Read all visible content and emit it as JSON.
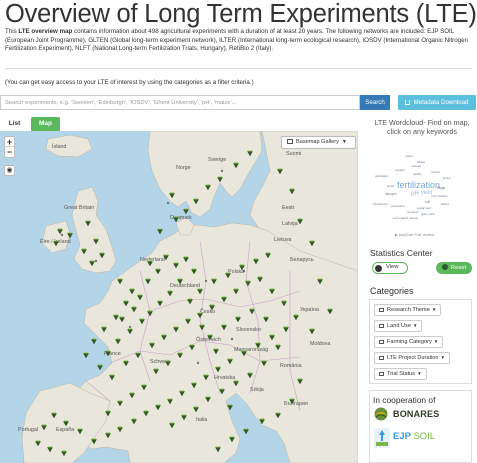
{
  "header": {
    "title": "Overview of Long Term Experiments (LTE)",
    "intro_part1": "This ",
    "intro_bold": "LTE overview map",
    "intro_part2": " contains information about 498 agricultural experiments with a duration of at least 20 years. The following networks are included: EJP SOIL (European Joint Programme), GLTEN (Global long-term experiment network), ILTER (International long-term ecological research), IOSDV (International Organic Nitrogen Fertilization Experiment), NLFT (National Long-term Fertilization Trials, Hungary), RetiBio 2 (Italy).",
    "hint": "(You can get easy access to your LTE of interest by using the categories as a filter criteria.)"
  },
  "search": {
    "placeholder": "Search experiments, e.g. 'Sweden', 'Edinburgh', 'IOSDV', 'Ghent University', 'pH', 'maize'...",
    "button_label": "Search"
  },
  "metadata_button": {
    "label": "Metadata Download",
    "icon": "download-icon"
  },
  "tabs": [
    {
      "label": "List",
      "active": false
    },
    {
      "label": "Map",
      "active": true
    }
  ],
  "map": {
    "zoom_in": "+",
    "zoom_out": "−",
    "basemap_label": "Basemap Gallery",
    "labels": [
      {
        "text": "Ísland"
      },
      {
        "text": "Norge"
      },
      {
        "text": "Sverige"
      },
      {
        "text": "Suomi"
      },
      {
        "text": "Eesti"
      },
      {
        "text": "Latvija"
      },
      {
        "text": "Lietuva"
      },
      {
        "text": "Danmark"
      },
      {
        "text": "Great Britain"
      },
      {
        "text": "Éire / Ireland"
      },
      {
        "text": "Nederland"
      },
      {
        "text": "Deutschland"
      },
      {
        "text": "Polska"
      },
      {
        "text": "Беларусь"
      },
      {
        "text": "Україна"
      },
      {
        "text": "France"
      },
      {
        "text": "Česko"
      },
      {
        "text": "Slovensko"
      },
      {
        "text": "Österreich"
      },
      {
        "text": "Magyarország"
      },
      {
        "text": "România"
      },
      {
        "text": "Italia"
      },
      {
        "text": "España"
      },
      {
        "text": "Portugal"
      },
      {
        "text": "Schweiz"
      },
      {
        "text": "Moldova"
      },
      {
        "text": "Hrvatska"
      },
      {
        "text": "Srbija"
      },
      {
        "text": "България"
      }
    ]
  },
  "wordcloud": {
    "title": "LTE Wordcloud- Find on map, click on any keywords",
    "words": [
      {
        "text": "fertilization"
      },
      {
        "text": "pH"
      },
      {
        "text": "yield"
      },
      {
        "text": "nitrogen"
      },
      {
        "text": "tillage"
      },
      {
        "text": "soil"
      },
      {
        "text": "crop rotation"
      },
      {
        "text": "manure"
      },
      {
        "text": "organic"
      },
      {
        "text": "grassland"
      },
      {
        "text": "maize"
      },
      {
        "text": "wheat"
      },
      {
        "text": "phosphorus"
      },
      {
        "text": "potassium"
      },
      {
        "text": "barley"
      },
      {
        "text": "carbon"
      },
      {
        "text": "straw"
      },
      {
        "text": "liming"
      },
      {
        "text": "compost"
      },
      {
        "text": "quality"
      },
      {
        "text": "soil organic carbon"
      },
      {
        "text": "sugar beet"
      },
      {
        "text": "grain yield"
      }
    ],
    "credit": "▶ AnyChart Trial Version"
  },
  "stats": {
    "heading": "Statistics Center",
    "view_label": "View",
    "reset_label": "Reset"
  },
  "categories": {
    "heading": "Categories",
    "items": [
      {
        "label": "Research Theme"
      },
      {
        "label": "Land Use"
      },
      {
        "label": "Farming Category"
      },
      {
        "label": "LTE Project Duration"
      },
      {
        "label": "Trial Status"
      }
    ]
  },
  "cooperation": {
    "heading": "In cooperation of",
    "bonares": "BONARES",
    "ejp_a": "EJP ",
    "ejp_b": "SOIL"
  }
}
